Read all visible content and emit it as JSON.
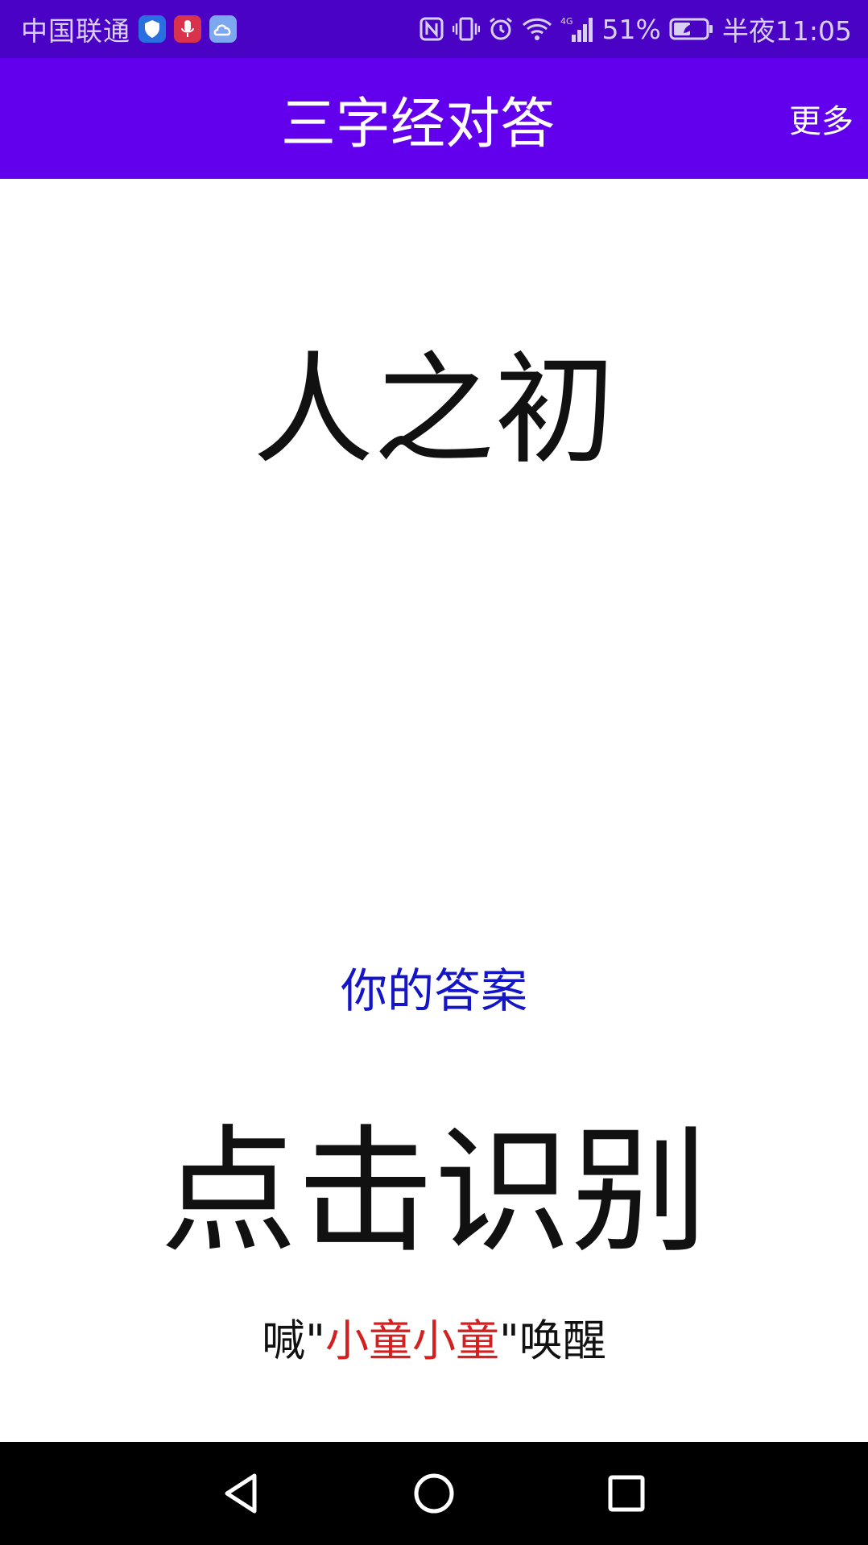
{
  "status_bar": {
    "carrier": "中国联通",
    "battery_percent": "51%",
    "time": "半夜11:05",
    "network_type": "4G",
    "icons": [
      "shield-app-icon",
      "mic-app-icon",
      "cloud-app-icon",
      "nfc-icon",
      "vibrate-icon",
      "alarm-icon",
      "wifi-icon",
      "signal-icon",
      "battery-icon"
    ]
  },
  "app_bar": {
    "title": "三字经对答",
    "more_label": "更多",
    "background": "#6200ee"
  },
  "content": {
    "question": "人之初",
    "answer_label": "你的答案",
    "recognize_label": "点击识别",
    "wake_hint": {
      "prefix": "喊\"",
      "wake_word": "小童小童",
      "suffix": "\"唤醒"
    }
  },
  "colors": {
    "status_bar": "#4a03c4",
    "app_bar": "#6200ee",
    "answer_label": "#1515c8",
    "wake_word": "#d32020"
  },
  "nav_bar": {
    "buttons": [
      "back-icon",
      "home-icon",
      "recents-icon"
    ]
  }
}
